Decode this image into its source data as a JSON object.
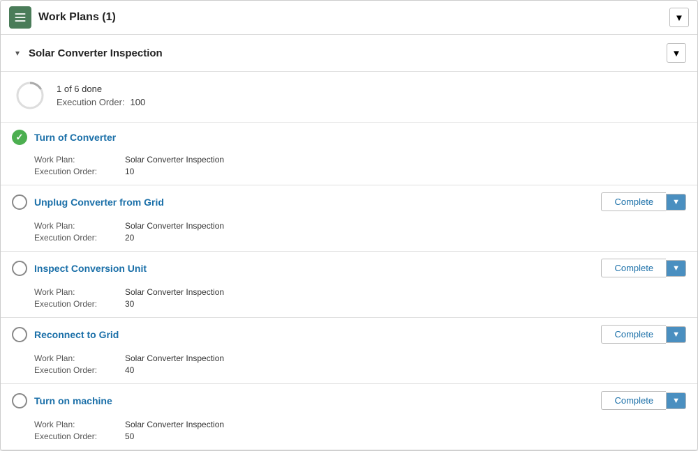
{
  "header": {
    "title": "Work Plans (1)",
    "icon_label": "work-plans-icon"
  },
  "section": {
    "title": "Solar Converter Inspection",
    "progress_text": "1 of 6 done",
    "execution_label": "Execution Order:",
    "execution_value": "100"
  },
  "tasks": [
    {
      "id": "turn-of-converter",
      "title": "Turn of Converter",
      "done": true,
      "work_plan_label": "Work Plan:",
      "work_plan_value": "Solar Converter Inspection",
      "execution_label": "Execution Order:",
      "execution_value": "10",
      "has_complete": false
    },
    {
      "id": "unplug-converter",
      "title": "Unplug Converter from Grid",
      "done": false,
      "work_plan_label": "Work Plan:",
      "work_plan_value": "Solar Converter Inspection",
      "execution_label": "Execution Order:",
      "execution_value": "20",
      "has_complete": true,
      "complete_label": "Complete"
    },
    {
      "id": "inspect-conversion",
      "title": "Inspect Conversion Unit",
      "done": false,
      "work_plan_label": "Work Plan:",
      "work_plan_value": "Solar Converter Inspection",
      "execution_label": "Execution Order:",
      "execution_value": "30",
      "has_complete": true,
      "complete_label": "Complete"
    },
    {
      "id": "reconnect-to-grid",
      "title": "Reconnect to Grid",
      "done": false,
      "work_plan_label": "Work Plan:",
      "work_plan_value": "Solar Converter Inspection",
      "execution_label": "Execution Order:",
      "execution_value": "40",
      "has_complete": true,
      "complete_label": "Complete"
    },
    {
      "id": "turn-on-machine",
      "title": "Turn on machine",
      "done": false,
      "work_plan_label": "Work Plan:",
      "work_plan_value": "Solar Converter Inspection",
      "execution_label": "Execution Order:",
      "execution_value": "50",
      "has_complete": true,
      "complete_label": "Complete"
    }
  ],
  "labels": {
    "chevron": "▼",
    "checkmark": "✓"
  }
}
